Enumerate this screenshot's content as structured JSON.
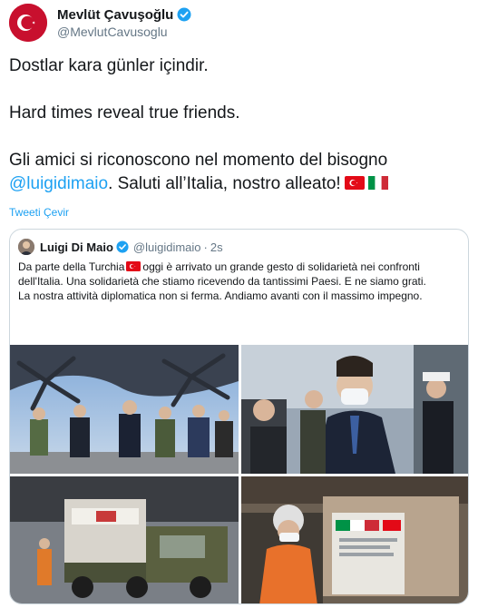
{
  "tweet": {
    "author": {
      "display_name": "Mevlüt Çavuşoğlu",
      "handle": "@MevlutCavusoglu",
      "verified": true,
      "avatar_icon": "turkish-flag-avatar"
    },
    "text": {
      "line1": "Dostlar kara günler içindir.",
      "line2": "Hard times reveal true friends.",
      "line3": "Gli amici si riconoscono nel momento del bisogno",
      "mention": "@luigidimaio",
      "line4_rest": ". Saluti all’Italia, nostro alleato!"
    },
    "emojis": [
      "turkey-flag",
      "italy-flag"
    ],
    "translate_label": "Tweeti Çevir"
  },
  "quoted": {
    "display_name": "Luigi Di Maio",
    "handle": "@luigidimaio",
    "separator": "·",
    "time": "2s",
    "verified": true,
    "text": {
      "part1": "Da parte della Turchia",
      "part2": "oggi è arrivato un grande gesto di solidarietà nei confronti dell'Italia. Una solidarietà che stiamo ricevendo da tantissimi Paesi. E ne siamo grati.",
      "part3": "La nostra attività diplomatica non si ferma. Andiamo avanti con il massimo impegno."
    },
    "media": [
      "photo-officials-aircraft",
      "photo-di-maio-mask",
      "photo-cargo-truck",
      "photo-worker-supplies"
    ]
  },
  "colors": {
    "brand_blue": "#1da1f2",
    "text_primary": "#14171a",
    "text_secondary": "#657786",
    "border": "#ccd6dd",
    "turkey_red": "#e30a17",
    "italy_green": "#009246",
    "italy_red": "#ce2b37"
  }
}
